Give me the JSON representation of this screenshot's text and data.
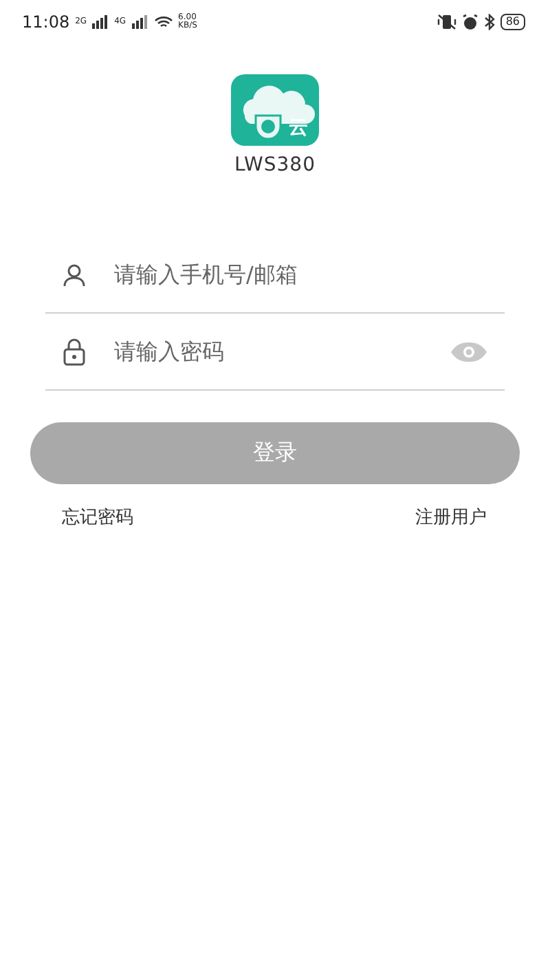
{
  "status_bar": {
    "time": "11:08",
    "sim_1": "2G",
    "sim_2": "4G",
    "speed_value": "6.00",
    "speed_unit": "KB/S",
    "battery": "86"
  },
  "app": {
    "logo_char": "云",
    "name": "LWS380"
  },
  "form": {
    "fields": [
      {
        "kind": "user",
        "placeholder": "请输入手机号/邮箱"
      },
      {
        "kind": "password",
        "placeholder": "请输入密码"
      }
    ],
    "login_button": {
      "label": "登录",
      "disabled": true
    },
    "links": [
      "忘记密码",
      "注册用户"
    ]
  }
}
